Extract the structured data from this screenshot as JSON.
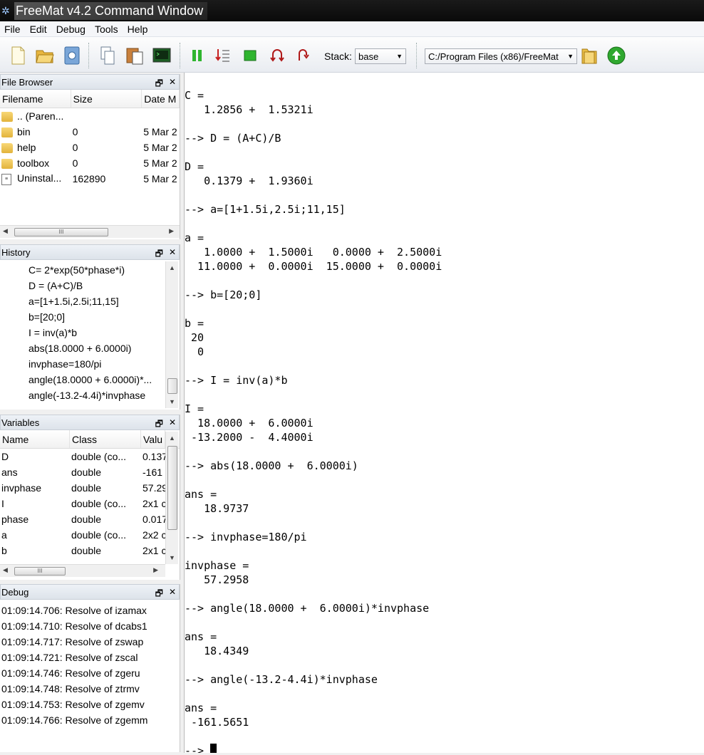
{
  "window": {
    "title": "FreeMat v4.2 Command Window"
  },
  "menu": [
    "File",
    "Edit",
    "Debug",
    "Tools",
    "Help"
  ],
  "toolbar": {
    "stack_label": "Stack:",
    "stack_value": "base",
    "path_value": "C:/Program Files (x86)/FreeMat"
  },
  "file_browser": {
    "title": "File Browser",
    "columns": [
      "Filename",
      "Size",
      "Date M"
    ],
    "rows": [
      {
        "icon": "folder-icon",
        "name": ".. (Paren...",
        "size": "",
        "date": ""
      },
      {
        "icon": "folder-icon",
        "name": "bin",
        "size": "0",
        "date": "5 Mar 2"
      },
      {
        "icon": "folder-icon",
        "name": "help",
        "size": "0",
        "date": "5 Mar 2"
      },
      {
        "icon": "folder-icon",
        "name": "toolbox",
        "size": "0",
        "date": "5 Mar 2"
      },
      {
        "icon": "file-icon",
        "name": "Uninstal...",
        "size": "162890",
        "date": "5 Mar 2"
      }
    ]
  },
  "history": {
    "title": "History",
    "items": [
      "C= 2*exp(50*phase*i)",
      "D = (A+C)/B",
      "a=[1+1.5i,2.5i;11,15]",
      "b=[20;0]",
      "I = inv(a)*b",
      "abs(18.0000 +  6.0000i)",
      "invphase=180/pi",
      "angle(18.0000 +  6.0000i)*...",
      "angle(-13.2-4.4i)*invphase"
    ]
  },
  "variables": {
    "title": "Variables",
    "columns": [
      "Name",
      "Class",
      "Valu"
    ],
    "rows": [
      {
        "name": "D",
        "class": "double (co...",
        "value": "0.137"
      },
      {
        "name": "ans",
        "class": "double",
        "value": "-161"
      },
      {
        "name": "invphase",
        "class": "double",
        "value": "57.29"
      },
      {
        "name": "I",
        "class": "double (co...",
        "value": "2x1 c"
      },
      {
        "name": "phase",
        "class": "double",
        "value": "0.017"
      },
      {
        "name": "a",
        "class": "double (co...",
        "value": "2x2 c"
      },
      {
        "name": "b",
        "class": "double",
        "value": "2x1 c"
      }
    ]
  },
  "debug": {
    "title": "Debug",
    "lines": [
      "01:09:14.706: Resolve of izamax",
      "01:09:14.710: Resolve of dcabs1",
      "01:09:14.717: Resolve of zswap",
      "01:09:14.721: Resolve of zscal",
      "01:09:14.746: Resolve of zgeru",
      "01:09:14.748: Resolve of ztrmv",
      "01:09:14.753: Resolve of zgemv",
      "01:09:14.766: Resolve of zgemm"
    ]
  },
  "console": {
    "lines": [
      "C =",
      "   1.2856 +  1.5321i",
      "",
      "--> D = (A+C)/B",
      "",
      "D =",
      "   0.1379 +  1.9360i",
      "",
      "--> a=[1+1.5i,2.5i;11,15]",
      "",
      "a =",
      "   1.0000 +  1.5000i   0.0000 +  2.5000i",
      "  11.0000 +  0.0000i  15.0000 +  0.0000i",
      "",
      "--> b=[20;0]",
      "",
      "b =",
      " 20",
      "  0",
      "",
      "--> I = inv(a)*b",
      "",
      "I =",
      "  18.0000 +  6.0000i",
      " -13.2000 -  4.4000i",
      "",
      "--> abs(18.0000 +  6.0000i)",
      "",
      "ans =",
      "   18.9737",
      "",
      "--> invphase=180/pi",
      "",
      "invphase =",
      "   57.2958",
      "",
      "--> angle(18.0000 +  6.0000i)*invphase",
      "",
      "ans =",
      "   18.4349",
      "",
      "--> angle(-13.2-4.4i)*invphase",
      "",
      "ans =",
      " -161.5651",
      ""
    ],
    "prompt": "--> "
  }
}
